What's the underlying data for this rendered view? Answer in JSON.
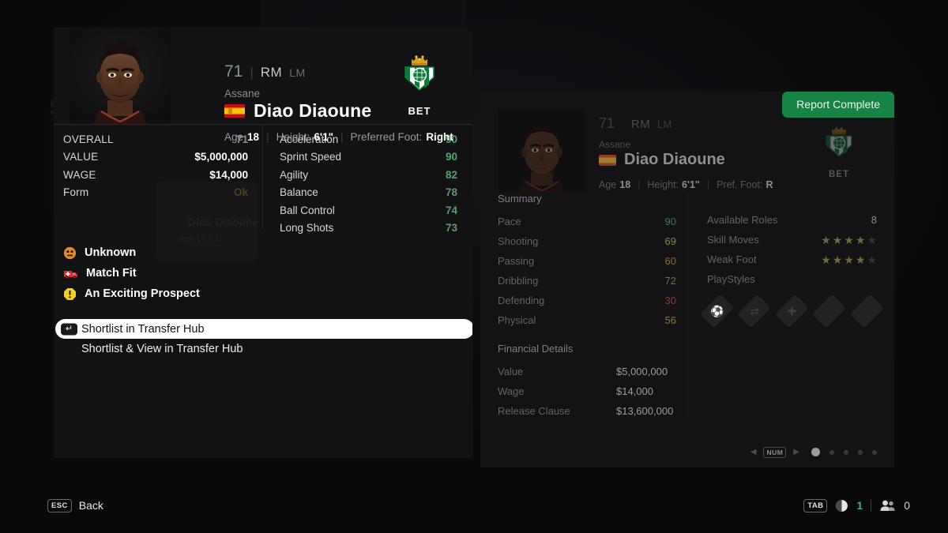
{
  "background": {
    "watermark": "SEARCH RESULTS"
  },
  "player_card": {
    "overall_rating": "71",
    "position_primary": "RM",
    "position_alt": "LM",
    "first_name": "Assane",
    "full_name": "Diao Diaoune",
    "nationality_flag": "spain-flag",
    "age_label": "Age",
    "age_value": "18",
    "height_label": "Height:",
    "height_value": "6'1\"",
    "foot_label": "Preferred Foot:",
    "foot_value": "Right",
    "club_crest": "real-betis-crest",
    "club_abbrev": "BET",
    "face_image": "player-face-photo",
    "stats_left": [
      {
        "key": "OVERALL",
        "value": "71",
        "color": "#7f9a7f"
      },
      {
        "key": "VALUE",
        "value": "$5,000,000",
        "color": "#ffffff"
      },
      {
        "key": "WAGE",
        "value": "$14,000",
        "color": "#ffffff"
      },
      {
        "key": "Form",
        "value": "Ok",
        "color": "#e0b33a"
      }
    ],
    "stats_right": [
      {
        "key": "Acceleration",
        "value": "90",
        "color": "#4fa866"
      },
      {
        "key": "Sprint Speed",
        "value": "90",
        "color": "#4fa866"
      },
      {
        "key": "Agility",
        "value": "82",
        "color": "#4fa866"
      },
      {
        "key": "Balance",
        "value": "78",
        "color": "#5f9a6d"
      },
      {
        "key": "Ball Control",
        "value": "74",
        "color": "#5f9a6d"
      },
      {
        "key": "Long Shots",
        "value": "73",
        "color": "#5f9a6d"
      }
    ],
    "status_items": [
      {
        "icon": "neutral-face-icon",
        "label": "Unknown"
      },
      {
        "icon": "ambulance-icon",
        "label": "Match Fit"
      },
      {
        "icon": "warning-octagon-icon",
        "label": "An Exciting Prospect"
      }
    ],
    "ghost_card": {
      "name": "Diao Diaoune",
      "meta": "Age 18    6'1\""
    }
  },
  "menu": {
    "enter_key_glyph": "↵",
    "items": [
      {
        "label": "Shortlist in Transfer Hub",
        "selected": true
      },
      {
        "label": "Shortlist & View in Transfer Hub",
        "selected": false
      }
    ]
  },
  "scout_report": {
    "badge_label": "Report Complete",
    "badge_color": "#168444",
    "header": {
      "overall_rating": "71",
      "position_primary": "RM",
      "position_alt": "LM",
      "first_name": "Assane",
      "full_name": "Diao Diaoune",
      "age_label": "Age",
      "age_value": "18",
      "height_label": "Height:",
      "height_value": "6'1\"",
      "foot_label": "Pref. Foot:",
      "foot_value": "R",
      "club_abbrev": "BET",
      "club_crest": "real-betis-crest"
    },
    "summary_title": "Summary",
    "summary_rows": [
      {
        "key": "Pace",
        "value": "90",
        "color": "#397a4d"
      },
      {
        "key": "Shooting",
        "value": "69",
        "color": "#87843f"
      },
      {
        "key": "Passing",
        "value": "60",
        "color": "#8a6a32"
      },
      {
        "key": "Dribbling",
        "value": "72",
        "color": "#6d7045"
      },
      {
        "key": "Defending",
        "value": "30",
        "color": "#8a3a36"
      },
      {
        "key": "Physical",
        "value": "56",
        "color": "#8a7a35"
      }
    ],
    "attributes": {
      "available_roles_label": "Available Roles",
      "available_roles_value": "8",
      "skill_moves_label": "Skill Moves",
      "skill_moves_filled": 4,
      "skill_moves_total": 5,
      "weak_foot_label": "Weak Foot",
      "weak_foot_filled": 4,
      "weak_foot_total": 5,
      "playstyles_label": "PlayStyles",
      "playstyles": [
        {
          "icon": "playstyle-badge-filled-1",
          "filled": true
        },
        {
          "icon": "playstyle-badge-filled-2",
          "filled": true
        },
        {
          "icon": "playstyle-badge-filled-3",
          "filled": true
        },
        {
          "icon": "playstyle-badge-empty-1",
          "filled": false
        },
        {
          "icon": "playstyle-badge-empty-2",
          "filled": false
        }
      ]
    },
    "financial_title": "Financial Details",
    "financial_rows": [
      {
        "key": "Value",
        "value": "$5,000,000"
      },
      {
        "key": "Wage",
        "value": "$14,000"
      },
      {
        "key": "Release Clause",
        "value": "$13,600,000"
      }
    ],
    "pager": {
      "key_label": "NUM",
      "left_arrow": "◀",
      "right_arrow": "▶",
      "total_pages": 5,
      "active_page": 1
    }
  },
  "bottom_bar": {
    "back_key": "ESC",
    "back_label": "Back",
    "tab_key": "TAB",
    "compare_icon": "contrast-circle-icon",
    "compare_count": "1",
    "squad_icon": "people-icon",
    "squad_count": "0"
  }
}
